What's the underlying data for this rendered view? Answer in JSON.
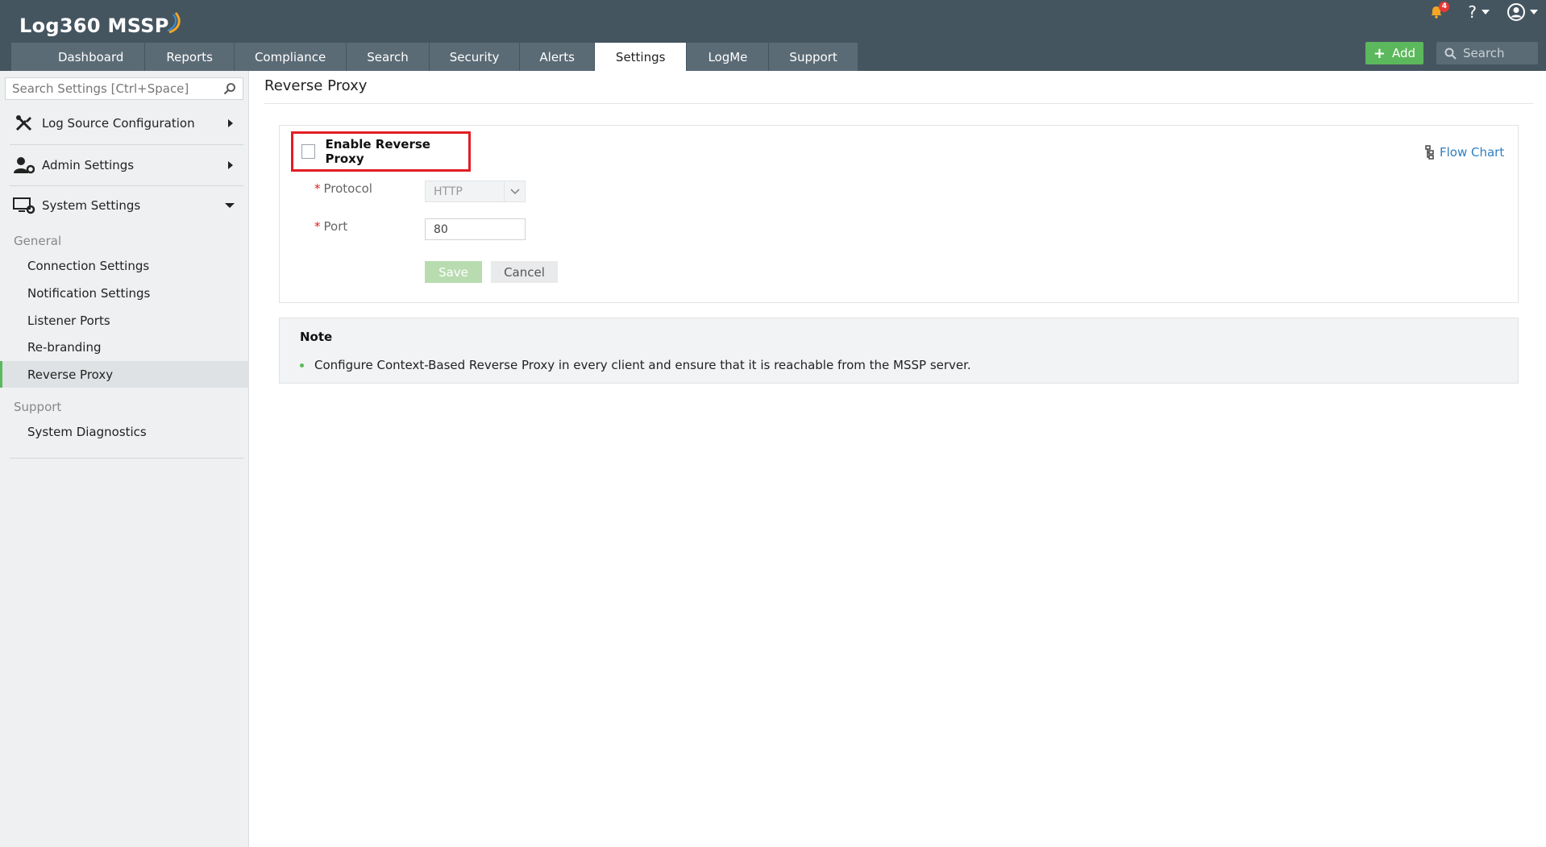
{
  "app": {
    "logo_text": "Log360 MSSP",
    "notification_count": "4"
  },
  "tabs": [
    {
      "label": "Dashboard"
    },
    {
      "label": "Reports"
    },
    {
      "label": "Compliance"
    },
    {
      "label": "Search"
    },
    {
      "label": "Security"
    },
    {
      "label": "Alerts"
    },
    {
      "label": "Settings",
      "active": true
    },
    {
      "label": "LogMe"
    },
    {
      "label": "Support"
    }
  ],
  "header": {
    "add_label": "Add",
    "search_placeholder": "Search"
  },
  "sidebar": {
    "search_placeholder": "Search Settings [Ctrl+Space]",
    "sections": [
      {
        "label": "Log Source Configuration",
        "icon": "tools-icon",
        "expanded": false
      },
      {
        "label": "Admin Settings",
        "icon": "admin-user-icon",
        "expanded": false
      },
      {
        "label": "System Settings",
        "icon": "monitor-gear-icon",
        "expanded": true
      }
    ],
    "groups": [
      {
        "label": "General",
        "items": [
          "Connection Settings",
          "Notification Settings",
          "Listener Ports",
          "Re-branding",
          "Reverse Proxy"
        ]
      },
      {
        "label": "Support",
        "items": [
          "System Diagnostics"
        ]
      }
    ],
    "active_item": "Reverse Proxy"
  },
  "main": {
    "title": "Reverse Proxy",
    "enable_label": "Enable Reverse Proxy",
    "enable_checked": false,
    "flow_chart_label": "Flow Chart",
    "required_mark": "*",
    "protocol_label": "Protocol",
    "protocol_value": "HTTP",
    "port_label": "Port",
    "port_value": "80",
    "save_label": "Save",
    "cancel_label": "Cancel",
    "note_title": "Note",
    "note_items": [
      "Configure Context-Based Reverse Proxy in every client and ensure that it is reachable from the MSSP server."
    ]
  },
  "colors": {
    "header_bg": "#455560",
    "tab_bg": "#5b6b76",
    "accent_green": "#5cb85c",
    "highlight_red": "#e31e24",
    "link_blue": "#2f7fc1"
  }
}
